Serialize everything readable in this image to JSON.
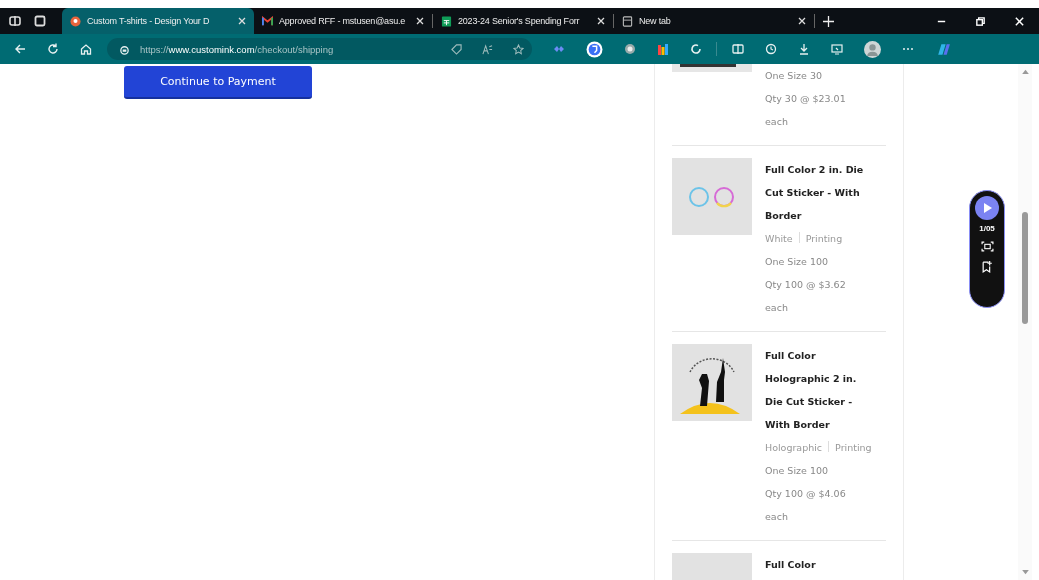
{
  "browser": {
    "tabs": [
      {
        "title": "Custom T-shirts - Design Your D",
        "kind": "site",
        "selected": true
      },
      {
        "title": "Approved RFF - mstusen@asu.e",
        "kind": "mail",
        "selected": false
      },
      {
        "title": "2023-24 Senior's Spending Forr",
        "kind": "sheet",
        "selected": false
      },
      {
        "title": "New tab",
        "kind": "newtab",
        "selected": false
      }
    ],
    "url": "https://**www.customink.com**/checkout/shipping"
  },
  "page": {
    "continue_button": "Continue to Payment",
    "order_items": [
      {
        "kind": "cut",
        "size": "One Size 30",
        "qty": "Qty 30 @ $23.01 each"
      },
      {
        "kind": "rings",
        "title": "Full Color 2 in. Die Cut Sticker - With Border",
        "variant": [
          "White",
          "Printing"
        ],
        "size": "One Size 100",
        "qty": "Qty 100 @ $3.62 each"
      },
      {
        "kind": "silhouette",
        "title": "Full Color Holographic 2 in. Die Cut Sticker - With Border",
        "variant": [
          "Holographic",
          "Printing"
        ],
        "size": "One Size 100",
        "qty": "Qty 100 @ $4.06 each"
      },
      {
        "kind": "blank",
        "title": "Full Color"
      }
    ]
  },
  "recorder": {
    "counter": "1/05"
  }
}
